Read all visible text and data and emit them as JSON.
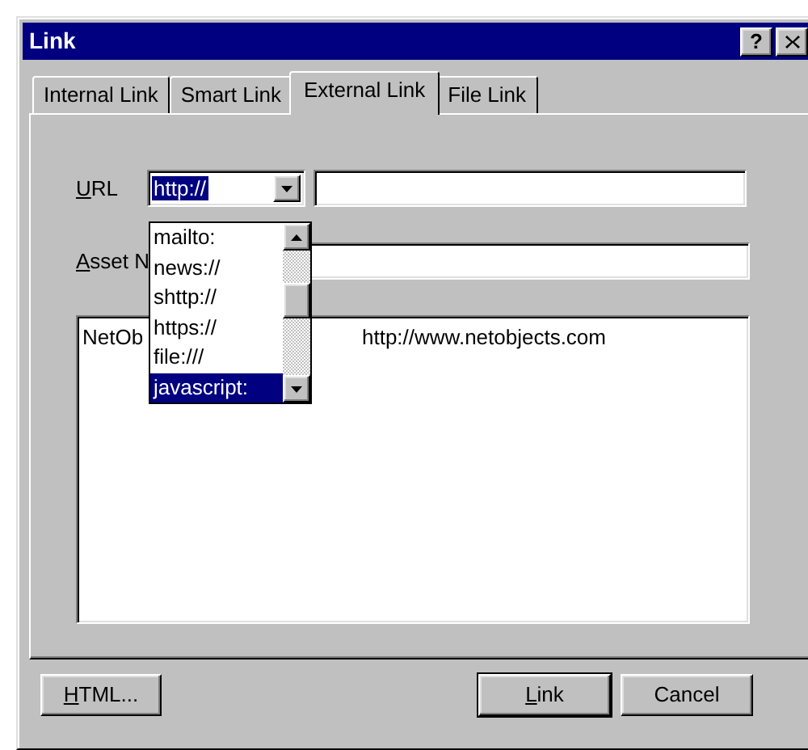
{
  "window": {
    "title": "Link",
    "help_label": "?"
  },
  "tabs": [
    {
      "label": "Internal Link",
      "selected": false
    },
    {
      "label": "Smart Link",
      "selected": false
    },
    {
      "label": "External Link",
      "selected": true
    },
    {
      "label": "File Link",
      "selected": false
    }
  ],
  "url": {
    "label": "URL",
    "mnemonic": true,
    "scheme": "http://"
  },
  "scheme_dropdown": {
    "items": [
      {
        "label": "mailto:",
        "selected": false
      },
      {
        "label": "news://",
        "selected": false
      },
      {
        "label": "shttp://",
        "selected": false
      },
      {
        "label": "https://",
        "selected": false
      },
      {
        "label": "file:///",
        "selected": false
      },
      {
        "label": "javascript:",
        "selected": true
      }
    ]
  },
  "asset_name": {
    "label": "Asset N",
    "mnemonic": true
  },
  "list": {
    "rows": [
      {
        "cells": [
          "NetOb",
          "http://www.netobjects.com"
        ]
      }
    ]
  },
  "left_buttons": [
    {
      "label": "HTML...",
      "mnemonic": true,
      "default": false
    }
  ],
  "right_buttons": [
    {
      "label": "Link",
      "mnemonic": true,
      "default": true
    },
    {
      "label": "Cancel",
      "mnemonic": false,
      "default": false
    }
  ]
}
